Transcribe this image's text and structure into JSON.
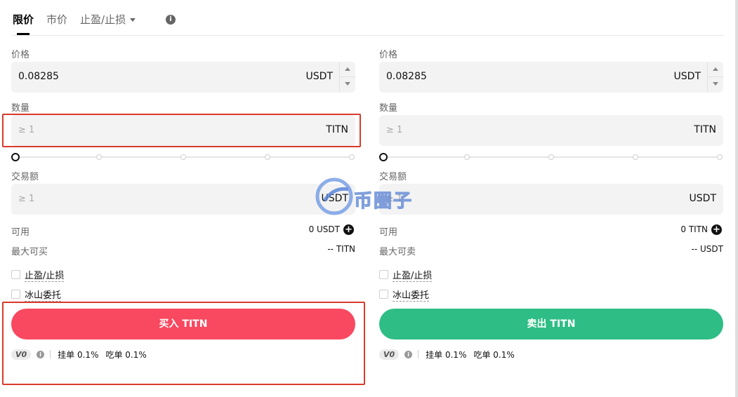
{
  "tabs": [
    {
      "label": "限价",
      "active": true
    },
    {
      "label": "市价",
      "active": false
    },
    {
      "label": "止盈/止损",
      "active": false
    }
  ],
  "info_icon": "i",
  "buy": {
    "price_label": "价格",
    "price_value": "0.08285",
    "price_unit": "USDT",
    "qty_label": "数量",
    "qty_placeholder": "≥ 1",
    "qty_unit": "TITN",
    "amount_label": "交易额",
    "amount_placeholder": "≥ 1",
    "amount_unit": "USDT",
    "available_label": "可用",
    "available_value": "0 USDT",
    "max_label": "最大可买",
    "max_value": "-- TITN",
    "tpsl_label": "止盈/止损",
    "iceberg_label": "冰山委托",
    "action_label": "买入 TITN",
    "action_color": "#f84960",
    "vip": "V0",
    "maker_fee": "挂单 0.1%",
    "taker_fee": "吃单 0.1%"
  },
  "sell": {
    "price_label": "价格",
    "price_value": "0.08285",
    "price_unit": "USDT",
    "qty_label": "数量",
    "qty_placeholder": "≥ 1",
    "qty_unit": "TITN",
    "amount_label": "交易额",
    "amount_placeholder": "≥ 1",
    "amount_unit": "USDT",
    "available_label": "可用",
    "available_value": "0 TITN",
    "max_label": "最大可卖",
    "max_value": "-- USDT",
    "tpsl_label": "止盈/止损",
    "iceberg_label": "冰山委托",
    "action_label": "卖出 TITN",
    "action_color": "#2ebd85",
    "vip": "V0",
    "maker_fee": "挂单 0.1%",
    "taker_fee": "吃单 0.1%"
  },
  "watermark": {
    "text": "币圈子"
  },
  "colors": {
    "highlight": "#d83a2c",
    "buy": "#f84960",
    "sell": "#2ebd85"
  }
}
